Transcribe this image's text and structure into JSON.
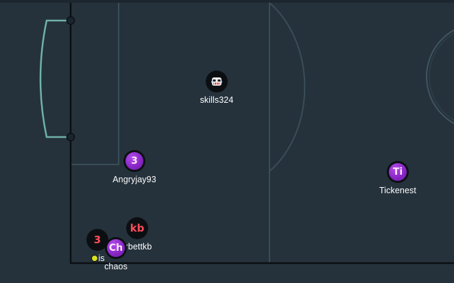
{
  "pitch": {
    "background_color": "#25323c",
    "line_color": "#3a4d58",
    "goal_color": "#6fb3a8",
    "boundary_color": "#0c0f12"
  },
  "players": [
    {
      "id": "skills324",
      "name": "skills324",
      "avatar_text": "",
      "avatar_icon": "robot-face-icon",
      "avatar_style": "dark"
    },
    {
      "id": "angryjay93",
      "name": "Angryjay93",
      "avatar_text": "3",
      "avatar_style": "purple"
    },
    {
      "id": "tickenest",
      "name": "Tickenest",
      "avatar_text": "Ti",
      "avatar_style": "purple"
    },
    {
      "id": "kb",
      "name": "rbettkb",
      "avatar_text": "kb",
      "avatar_style": "dark-red"
    },
    {
      "id": "p3",
      "name": "is",
      "avatar_text": "3",
      "avatar_style": "dark-red"
    },
    {
      "id": "chaos",
      "name": "chaos",
      "avatar_text": "Ch",
      "avatar_style": "purple"
    }
  ],
  "ball": {
    "color": "#d9e021"
  }
}
